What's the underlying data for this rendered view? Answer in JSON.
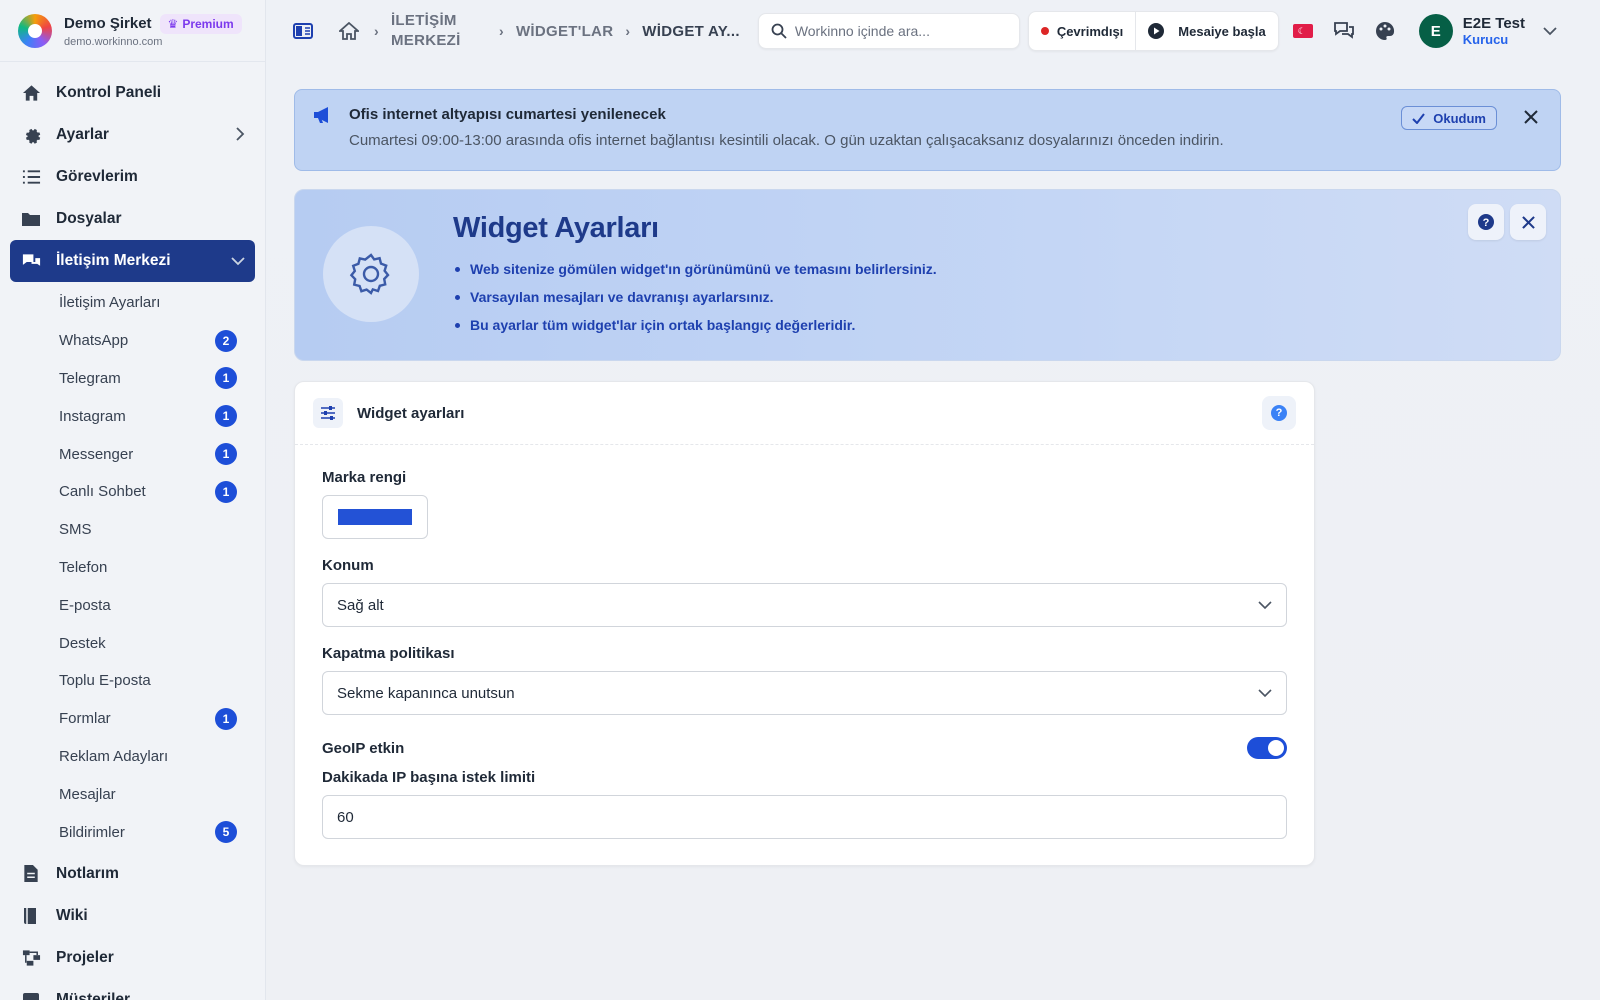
{
  "brand": {
    "name": "Demo Şirket",
    "badge": "Premium",
    "domain": "demo.workinno.com"
  },
  "sidebar": {
    "items": [
      {
        "label": "Kontrol Paneli",
        "icon": "home-icon"
      },
      {
        "label": "Ayarlar",
        "icon": "gear-icon"
      },
      {
        "label": "Görevlerim",
        "icon": "tasks-icon"
      },
      {
        "label": "Dosyalar",
        "icon": "folder-icon"
      },
      {
        "label": "İletişim Merkezi",
        "icon": "chat-icon"
      }
    ],
    "subitems": [
      {
        "label": "İletişim Ayarları",
        "badge": ""
      },
      {
        "label": "WhatsApp",
        "badge": "2"
      },
      {
        "label": "Telegram",
        "badge": "1"
      },
      {
        "label": "Instagram",
        "badge": "1"
      },
      {
        "label": "Messenger",
        "badge": "1"
      },
      {
        "label": "Canlı Sohbet",
        "badge": "1"
      },
      {
        "label": "SMS",
        "badge": ""
      },
      {
        "label": "Telefon",
        "badge": ""
      },
      {
        "label": "E-posta",
        "badge": ""
      },
      {
        "label": "Destek",
        "badge": ""
      },
      {
        "label": "Toplu E-posta",
        "badge": ""
      },
      {
        "label": "Formlar",
        "badge": "1"
      },
      {
        "label": "Reklam Adayları",
        "badge": ""
      },
      {
        "label": "Mesajlar",
        "badge": ""
      },
      {
        "label": "Bildirimler",
        "badge": "5"
      }
    ],
    "bottom": [
      {
        "label": "Notlarım",
        "icon": "note-icon"
      },
      {
        "label": "Wiki",
        "icon": "book-icon"
      },
      {
        "label": "Projeler",
        "icon": "projects-icon"
      },
      {
        "label": "Müşteriler",
        "icon": "customers-icon"
      }
    ]
  },
  "topbar": {
    "breadcrumb": {
      "first": "İLETİŞİM MERKEZİ",
      "second": "WİDGET'LAR",
      "current": "WİDGET AY..."
    },
    "search_placeholder": "Workinno içinde ara...",
    "status": "Çevrimdışı",
    "shift": "Mesaiye başla",
    "user": {
      "initial": "E",
      "name": "E2E Test",
      "role": "Kurucu"
    }
  },
  "notice": {
    "title": "Ofis internet altyapısı cumartesi yenilenecek",
    "text": "Cumartesi 09:00-13:00 arasında ofis internet bağlantısı kesintili olacak. O gün uzaktan çalışacaksanız dosyalarınızı önceden indirin.",
    "ack": "Okudum"
  },
  "hero": {
    "title": "Widget Ayarları",
    "bullets": [
      "Web sitenize gömülen widget'ın görünümünü ve temasını belirlersiniz.",
      "Varsayılan mesajları ve davranışı ayarlarsınız.",
      "Bu ayarlar tüm widget'lar için ortak başlangıç değerleridir."
    ]
  },
  "card": {
    "title": "Widget ayarları",
    "help": "?",
    "brand_color_label": "Marka rengi",
    "brand_color": "#2352d6",
    "position_label": "Konum",
    "position_value": "Sağ alt",
    "close_policy_label": "Kapatma politikası",
    "close_policy_value": "Sekme kapanınca unutsun",
    "geoip_label": "GeoIP etkin",
    "geoip_enabled": true,
    "rate_limit_label": "Dakikada IP başına istek limiti",
    "rate_limit_value": "60"
  }
}
